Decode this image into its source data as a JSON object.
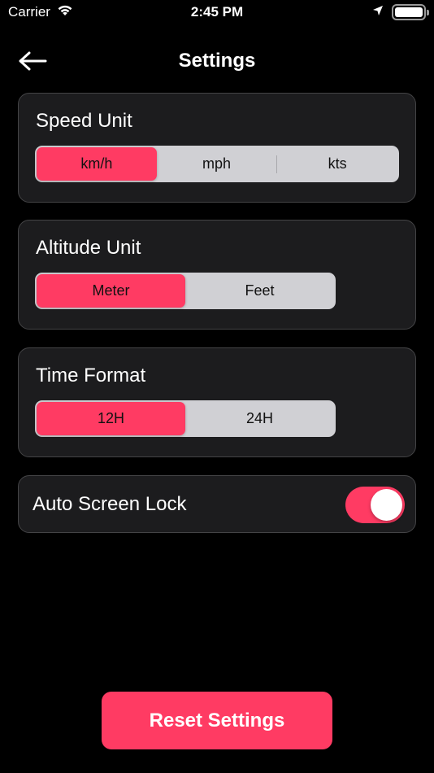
{
  "status_bar": {
    "carrier": "Carrier",
    "time": "2:45 PM",
    "icons": [
      "wifi-icon",
      "location-arrow-icon",
      "battery-icon"
    ]
  },
  "nav": {
    "back_icon": "back-arrow-icon",
    "title": "Settings"
  },
  "speed_unit": {
    "title": "Speed Unit",
    "options": [
      "km/h",
      "mph",
      "kts"
    ],
    "selected": "km/h"
  },
  "altitude_unit": {
    "title": "Altitude Unit",
    "options": [
      "Meter",
      "Feet"
    ],
    "selected": "Meter"
  },
  "time_format": {
    "title": "Time Format",
    "options": [
      "12H",
      "24H"
    ],
    "selected": "12H"
  },
  "auto_screen_lock": {
    "label": "Auto Screen Lock",
    "enabled": true
  },
  "reset": {
    "label": "Reset Settings"
  },
  "colors": {
    "accent": "#ff3b63",
    "background": "#000000",
    "card": "#1c1c1e",
    "card_border": "#444446",
    "segment_bg": "#d0d0d4"
  }
}
